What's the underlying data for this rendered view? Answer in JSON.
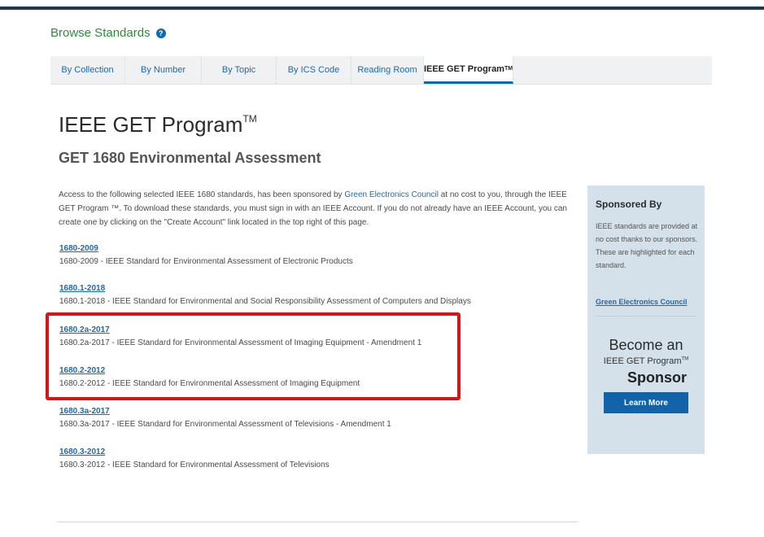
{
  "browse": {
    "title": "Browse Standards",
    "help_icon": "?"
  },
  "tabs": [
    {
      "label": "By Collection"
    },
    {
      "label": "By Number"
    },
    {
      "label": "By Topic"
    },
    {
      "label": "By ICS Code"
    },
    {
      "label": "Reading Room"
    },
    {
      "label": "IEEE GET Program",
      "tm": "TM",
      "active": true
    }
  ],
  "page": {
    "title": "IEEE GET Program",
    "title_tm": "TM",
    "subtitle": "GET 1680 Environmental Assessment",
    "intro": {
      "before_link": "Access to the following selected IEEE 1680 standards, has been sponsored by ",
      "link": "Green Electronics Council",
      "after_link": " at no cost to you, through the IEEE GET Program ™. To download these standards, you must sign in with an IEEE Account. If you do not already have an IEEE Account, you can create one by clicking on the \"Create Account\" link located in the top right of this page."
    }
  },
  "standards": [
    {
      "code": "1680-2009",
      "description": "1680-2009 - IEEE Standard for Environmental Assessment of Electronic Products"
    },
    {
      "code": "1680.1-2018",
      "description": "1680.1-2018 - IEEE Standard for Environmental and Social Responsibility Assessment of Computers and Displays"
    },
    {
      "code": "1680.2a-2017",
      "description": "1680.2a-2017 - IEEE Standard for Environmental Assessment of Imaging Equipment - Amendment 1"
    },
    {
      "code": "1680.2-2012",
      "description": "1680.2-2012 - IEEE Standard for Environmental Assessment of Imaging Equipment"
    },
    {
      "code": "1680.3a-2017",
      "description": "1680.3a-2017 - IEEE Standard for Environmental Assessment of Televisions - Amendment 1"
    },
    {
      "code": "1680.3-2012",
      "description": "1680.3-2012 - IEEE Standard for Environmental Assessment of Televisions"
    }
  ],
  "sidebar": {
    "title": "Sponsored By",
    "text": "IEEE standards are provided at no cost thanks to our sponsors. These are highlighted for each standard.",
    "sponsor_link": "Green Electronics Council",
    "promo_line1": "Become an",
    "promo_line2": "IEEE GET Program",
    "promo_tm": "TM",
    "promo_line3": "Sponsor",
    "button": "Learn More"
  },
  "colors": {
    "brand_green": "#2e8b3e",
    "link_blue": "#1f6aa5",
    "highlight_red": "#d8141b",
    "sidebar_bg": "#d4e1ea"
  }
}
